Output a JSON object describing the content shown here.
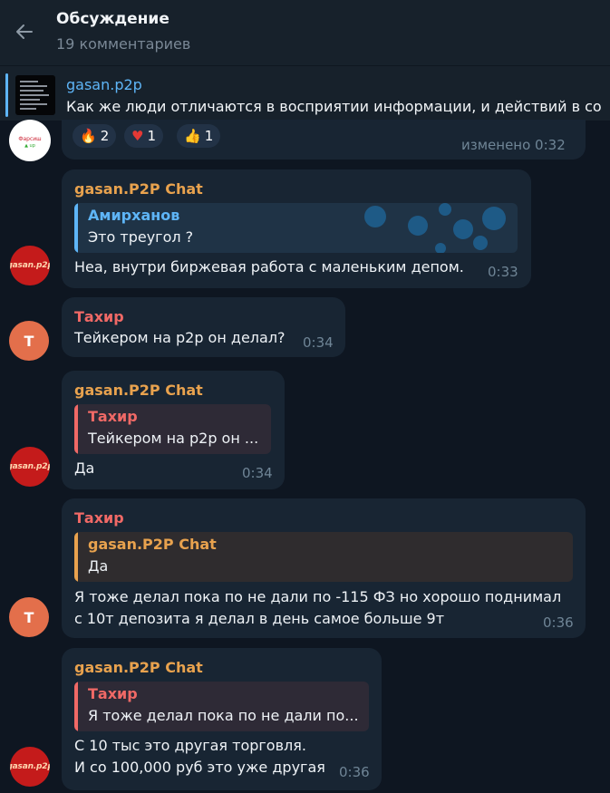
{
  "header": {
    "title": "Обсуждение",
    "subtitle": "19 комментариев"
  },
  "pinned": {
    "channel": "gasan.p2p",
    "text": "Как же люди отличаются в восприятии информации, и действий в со"
  },
  "first_post": {
    "reactions": [
      {
        "emoji": "🔥",
        "count": "2"
      },
      {
        "emoji": "♥",
        "count": "1"
      },
      {
        "emoji": "👍",
        "count": "1"
      }
    ],
    "edited_time": "изменено 0:32"
  },
  "messages": [
    {
      "sender": "gasan.P2P Chat",
      "reply_name": "Амирханов",
      "reply_text": "Это треугол ?",
      "text": "Неа, внутри биржевая работа с маленьким депом.",
      "time": "0:33"
    },
    {
      "sender": "Тахир",
      "avatar_letter": "T",
      "text": "Тейкером на p2p он делал?",
      "time": "0:34"
    },
    {
      "sender": "gasan.P2P Chat",
      "reply_name": "Тахир",
      "reply_text": "Тейкером на p2p он ...",
      "text": "Да",
      "time": "0:34"
    },
    {
      "sender": "Тахир",
      "avatar_letter": "T",
      "reply_name": "gasan.P2P Chat",
      "reply_text": "Да",
      "text_line1": "Я тоже делал пока по не дали по -115 ФЗ но хорошо поднимал",
      "text_line2": "с 10т депозита я делал в день самое больше 9т",
      "time": "0:36"
    },
    {
      "sender": "gasan.P2P Chat",
      "reply_name": "Тахир",
      "reply_text": "Я тоже делал пока по не дали по...",
      "text_line1": "С 10 тыс это другая торговля.",
      "text_line2": "И со 100,000 руб это уже другая",
      "time": "0:36"
    }
  ],
  "avatar_logo_text": "gasan.p2p",
  "colors": {
    "background": "#0e1621",
    "bubble": "#182533",
    "accent_blue": "#5eb5f7",
    "name_gold": "#e8a24e",
    "name_red": "#f06966"
  }
}
